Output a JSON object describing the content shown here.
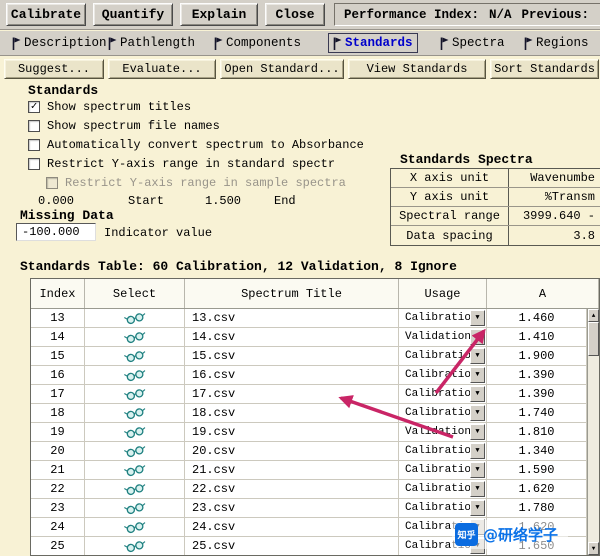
{
  "toolbar": {
    "buttons": [
      "Calibrate",
      "Quantify",
      "Explain",
      "Close"
    ],
    "performance_label": "Performance Index:",
    "performance_value": "N/A",
    "previous_label": "Previous:"
  },
  "tabs": {
    "items": [
      "Description",
      "Pathlength",
      "Components",
      "Standards",
      "Spectra",
      "Regions"
    ],
    "active": "Standards"
  },
  "actions": [
    "Suggest...",
    "Evaluate...",
    "Open Standard...",
    "View Standards",
    "Sort Standards"
  ],
  "standards_section": {
    "title": "Standards",
    "checkboxes": [
      {
        "label": "Show spectrum titles",
        "checked": true,
        "disabled": false
      },
      {
        "label": "Show spectrum file names",
        "checked": false,
        "disabled": false
      },
      {
        "label": "Automatically convert spectrum to Absorbance",
        "checked": false,
        "disabled": false
      },
      {
        "label": "Restrict Y-axis range in standard spectr",
        "checked": false,
        "disabled": false
      },
      {
        "label": "Restrict Y-axis range in sample spectra",
        "checked": false,
        "disabled": true
      }
    ],
    "range": {
      "start_value": "0.000",
      "start_label": "Start",
      "end_value": "1.500",
      "end_label": "End"
    }
  },
  "missing_data": {
    "title": "Missing Data",
    "indicator_value": "-100.000",
    "indicator_label": "Indicator value"
  },
  "spectra_panel": {
    "title": "Standards Spectra",
    "rows": [
      {
        "label": "X axis unit",
        "value": "Wavenumbe"
      },
      {
        "label": "Y axis unit",
        "value": "%Transm"
      },
      {
        "label": "Spectral range",
        "value": "3999.640 -"
      },
      {
        "label": "Data spacing",
        "value": "3.8"
      }
    ]
  },
  "standards_table": {
    "title": "Standards Table: 60 Calibration, 12 Validation, 8 Ignore",
    "columns": [
      "Index",
      "Select",
      "Spectrum Title",
      "Usage",
      "A"
    ],
    "rows": [
      {
        "index": "13",
        "title": "13.csv",
        "usage": "Calibration",
        "a": "1.460"
      },
      {
        "index": "14",
        "title": "14.csv",
        "usage": "Validation",
        "a": "1.410"
      },
      {
        "index": "15",
        "title": "15.csv",
        "usage": "Calibration",
        "a": "1.900"
      },
      {
        "index": "16",
        "title": "16.csv",
        "usage": "Calibration",
        "a": "1.390"
      },
      {
        "index": "17",
        "title": "17.csv",
        "usage": "Calibration",
        "a": "1.390"
      },
      {
        "index": "18",
        "title": "18.csv",
        "usage": "Calibration",
        "a": "1.740"
      },
      {
        "index": "19",
        "title": "19.csv",
        "usage": "Validation",
        "a": "1.810"
      },
      {
        "index": "20",
        "title": "20.csv",
        "usage": "Calibration",
        "a": "1.340"
      },
      {
        "index": "21",
        "title": "21.csv",
        "usage": "Calibration",
        "a": "1.590"
      },
      {
        "index": "22",
        "title": "22.csv",
        "usage": "Calibration",
        "a": "1.620"
      },
      {
        "index": "23",
        "title": "23.csv",
        "usage": "Calibration",
        "a": "1.780"
      },
      {
        "index": "24",
        "title": "24.csv",
        "usage": "Calibration",
        "a": "1.620"
      },
      {
        "index": "25",
        "title": "25.csv",
        "usage": "Calibration",
        "a": "1.650"
      }
    ]
  },
  "annotations": {
    "arrow_color": "#c92566"
  },
  "watermark": {
    "logo": "知乎",
    "handle": "@研络学子"
  },
  "colors": {
    "background": "#f8f2d5",
    "toolbar": "#d4d0c8",
    "active_tab_text": "#0000cc",
    "arrow": "#c92566",
    "watermark_blue": "#0b72e8",
    "glasses_teal": "#1f8080"
  }
}
